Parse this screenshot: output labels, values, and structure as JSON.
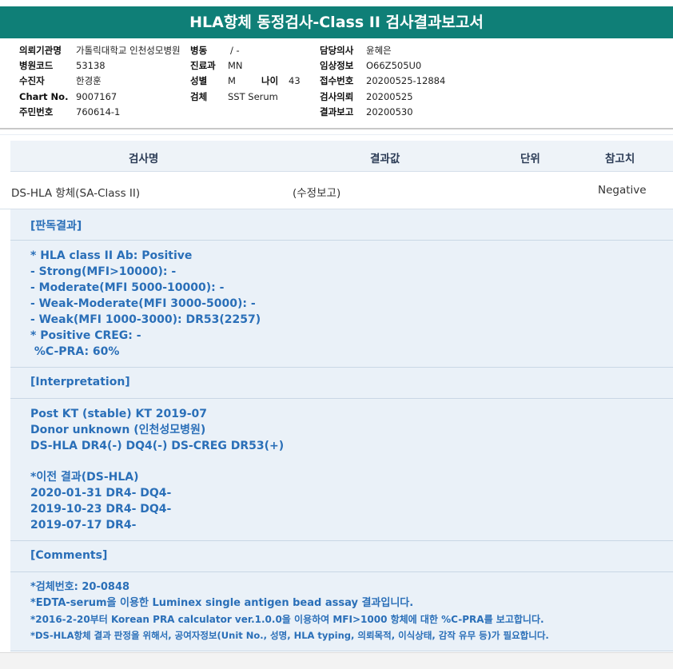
{
  "title": "HLA항체 동정검사-Class II 검사결과보고서",
  "meta": {
    "hospital_label": "의뢰기관명",
    "hospital_value": "가톨릭대학교 인천성모병원",
    "ward_label": "병동",
    "ward_value": "/ -",
    "doctor_label": "담당의사",
    "doctor_value": "윤혜은",
    "code_label": "병원코드",
    "code_value": "53138",
    "dept_label": "진료과",
    "dept_value": "MN",
    "clinical_label": "임상정보",
    "clinical_value": "O66Z505U0",
    "collector_label": "수진자",
    "collector_value": "한경훈",
    "sex_label": "성별",
    "sex_value": "M",
    "age_label": "나이",
    "age_value": "43",
    "receipt_label": "접수번호",
    "receipt_value": "20200525-12884",
    "chart_label": "Chart No.",
    "chart_value": "9007167",
    "specimen_label": "검체",
    "specimen_value": "SST Serum",
    "request_label": "검사의뢰",
    "request_value": "20200525",
    "rrn_label": "주민번호",
    "rrn_value": "760614-1",
    "report_label": "결과보고",
    "report_value": "20200530"
  },
  "table": {
    "headers": [
      "검사명",
      "결과값",
      "단위",
      "참고치"
    ],
    "row": {
      "test_name": "DS-HLA 항체(SA-Class II)",
      "result": "(수정보고)",
      "unit": "",
      "reference": "Negative"
    }
  },
  "judgement": {
    "header": "[판독결과]",
    "lines": [
      "* HLA class II Ab: Positive",
      "- Strong(MFI>10000): -",
      "- Moderate(MFI 5000-10000): -",
      "- Weak-Moderate(MFI 3000-5000): -",
      "- Weak(MFI 1000-3000): DR53(2257)",
      "* Positive CREG: -",
      " %C-PRA: 60%"
    ]
  },
  "interpretation": {
    "header": "[Interpretation]",
    "lines": [
      "Post KT (stable) KT 2019-07",
      "Donor unknown (인천성모병원)",
      "DS-HLA DR4(-) DQ4(-) DS-CREG DR53(+)",
      "",
      "*이전 결과(DS-HLA)",
      "2020-01-31 DR4- DQ4-",
      "2019-10-23 DR4- DQ4-",
      "2019-07-17 DR4-"
    ]
  },
  "comments": {
    "header": "[Comments]",
    "lines": [
      "*검체번호: 20-0848",
      "*EDTA-serum을 이용한 Luminex single antigen bead assay 결과입니다.",
      "*2016-2-20부터 Korean PRA calculator ver.1.0.0을 이용하여 MFI>1000 항체에 대한 %C-PRA를 보고합니다.",
      "*DS-HLA항체 결과 판정을 위해서, 공여자정보(Unit No., 성명, HLA typing, 의뢰목적, 이식상태, 감작 유무 등)가 필요합니다."
    ]
  },
  "colors": {
    "title_bg": "#0f7f77",
    "section_bg": "#eaf1f8",
    "section_text": "#2a6fb8"
  }
}
